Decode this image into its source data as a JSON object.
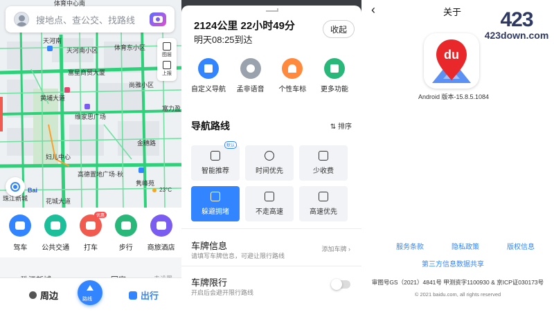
{
  "map_screen": {
    "search": {
      "placeholder": "搜地点、查公交、找路线"
    },
    "side_tools": [
      {
        "label": "图层"
      },
      {
        "label": "上报"
      }
    ],
    "map_labels": [
      "体育中心南",
      "天河南",
      "天河南小区",
      "体育东小区",
      "富星商贸大厦",
      "尚雅小区",
      "富力盈",
      "黄埔大道",
      "维家思广场",
      "金穗路",
      "妇儿中心",
      "高德置地广场·秋",
      "隽峰苑",
      "花城大道",
      "珠江新城"
    ],
    "baidu_logo": "Bai",
    "weather": {
      "temp": "23°C"
    },
    "quick_actions": [
      {
        "label": "驾车",
        "color": "#3385ff"
      },
      {
        "label": "公共交通",
        "color": "#1dbf9a"
      },
      {
        "label": "打车",
        "color": "#f05a4f",
        "badge": "优惠"
      },
      {
        "label": "步行",
        "color": "#2ab77a"
      },
      {
        "label": "商旅酒店",
        "color": "#7a5cf0"
      }
    ],
    "recent": [
      {
        "label": "珠江新城"
      },
      {
        "label": "回家"
      },
      {
        "label": "去设置"
      }
    ],
    "bottom_nav": {
      "nearby": "周边",
      "route": "路线",
      "trip": "出行"
    }
  },
  "nav_screen": {
    "summary_main": "2124公里 22小时49分",
    "summary_sub": "明天08:25到达",
    "collapse": "收起",
    "features": [
      {
        "label": "自定义导航",
        "color": "#3385ff"
      },
      {
        "label": "孟非语音",
        "color": "#9aa3ad"
      },
      {
        "label": "个性车标",
        "color": "#ff8a3d"
      },
      {
        "label": "更多功能",
        "color": "#2ab77a"
      }
    ],
    "routes_title": "导航路线",
    "sort": "排序",
    "route_options": [
      {
        "label": "智能推荐",
        "badge": "默认"
      },
      {
        "label": "时间优先"
      },
      {
        "label": "少收费"
      },
      {
        "label": "躲避拥堵",
        "active": true
      },
      {
        "label": "不走高速"
      },
      {
        "label": "高速优先"
      }
    ],
    "plate_info": {
      "title": "车牌信息",
      "desc": "请填写车牌信息，可避让限行路线",
      "action": "添加车牌"
    },
    "plate_limit": {
      "title": "车牌限行",
      "desc": "开启后会避开限行路线",
      "enabled": false
    }
  },
  "about_screen": {
    "back": "‹",
    "title": "关于",
    "watermark_num": "423",
    "watermark_domain": "423down.com",
    "logo_text": "du",
    "version": "Android 版本-15.8.5.1084",
    "links": [
      "服务条款",
      "隐私政策",
      "版权信息"
    ],
    "share_link": "第三方信息数据共享",
    "license": "审图号GS（2021）4841号 甲测资字1100930 & 京ICP证030173号",
    "copyright": "© 2021 baidu.com, all rights reserved"
  },
  "colors": {
    "accent": "#3385ff",
    "road": "#2fd07a",
    "map_bg": "#eef1f3"
  }
}
